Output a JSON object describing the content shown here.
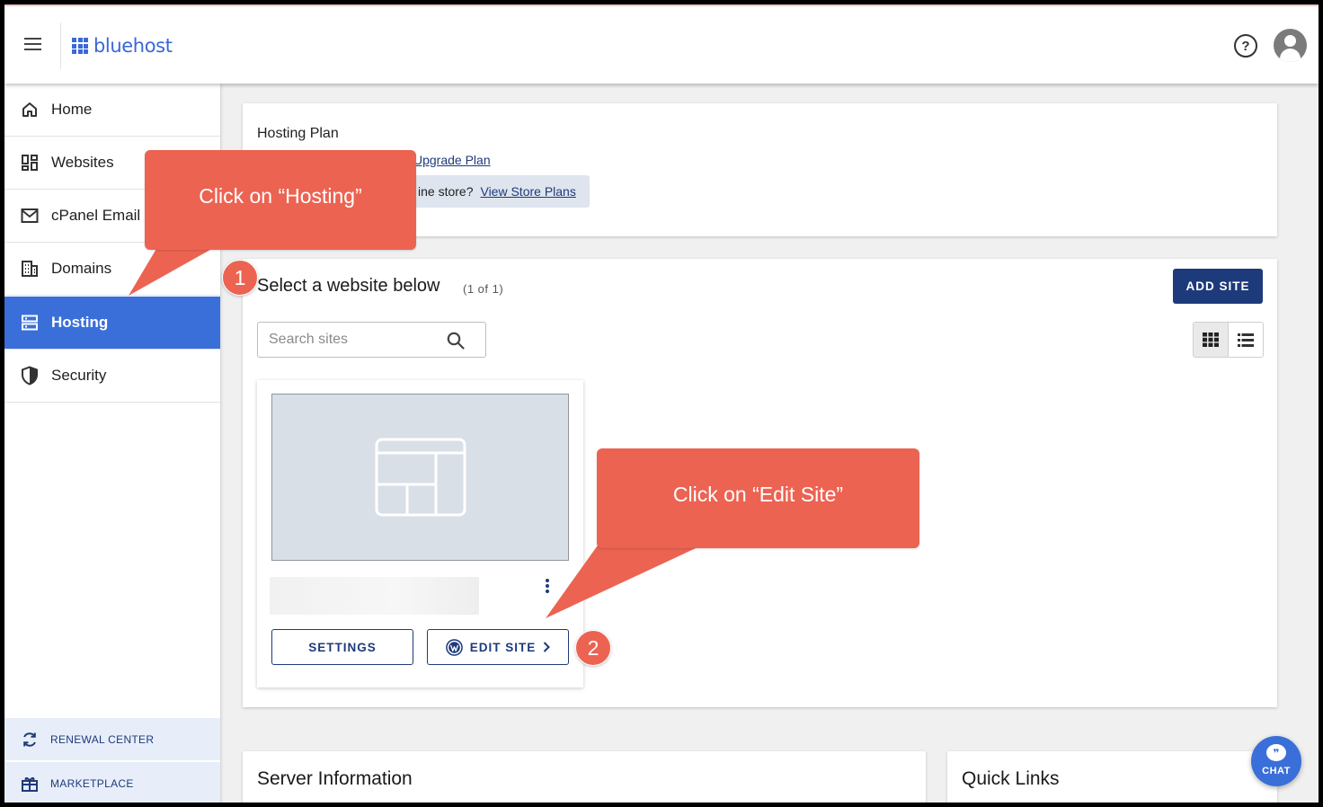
{
  "brand": {
    "name": "bluehost",
    "color": "#3a68d6"
  },
  "colors": {
    "accent": "#3a6fd9",
    "navy": "#1d3a7a",
    "annotation": "#ec6352"
  },
  "sidebar": {
    "items": [
      {
        "label": "Home",
        "icon": "home-icon"
      },
      {
        "label": "Websites",
        "icon": "dashboard-grid-icon"
      },
      {
        "label": "cPanel Email",
        "icon": "mail-icon"
      },
      {
        "label": "Domains",
        "icon": "building-icon"
      },
      {
        "label": "Hosting",
        "icon": "server-icon",
        "active": true
      },
      {
        "label": "Security",
        "icon": "shield-icon"
      }
    ],
    "bottom": [
      {
        "label": "RENEWAL CENTER",
        "icon": "refresh-icon"
      },
      {
        "label": "MARKETPLACE",
        "icon": "gift-icon"
      }
    ]
  },
  "plan": {
    "title": "Hosting Plan",
    "upgrade_link": "Upgrade Plan",
    "store_prompt": "ine store?",
    "store_link": "View Store Plans"
  },
  "sites": {
    "title": "Select a website below",
    "count": "(1 of 1)",
    "add_site_label": "ADD SITE",
    "search_placeholder": "Search sites",
    "card": {
      "settings_label": "SETTINGS",
      "edit_label": "EDIT SITE"
    }
  },
  "server": {
    "title": "Server Information"
  },
  "quick_links": {
    "title": "Quick Links"
  },
  "chat": {
    "label": "CHAT"
  },
  "annotations": {
    "callout_1": "Click on “Hosting”",
    "callout_2": "Click on “Edit Site”",
    "badge_1": "1",
    "badge_2": "2"
  }
}
